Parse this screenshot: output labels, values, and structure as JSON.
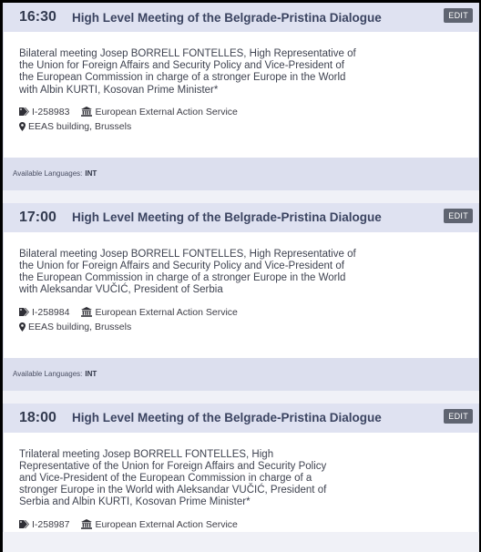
{
  "meetings": [
    {
      "time": "16:30",
      "title": "High Level Meeting of the Belgrade-Pristina Dialogue",
      "edit_label": "EDIT",
      "description": "Bilateral meeting Josep BORRELL FONTELLES, High Representative of the Union for Foreign Affairs and Security Policy and Vice-President of the European Commission in charge of a stronger Europe in the World with Albin KURTI, Kosovan Prime Minister*",
      "reference": "I-258983",
      "organizer": "European External Action Service",
      "location": "EEAS building, Brussels",
      "languages_label": "Available Languages:",
      "languages": "INT"
    },
    {
      "time": "17:00",
      "title": "High Level Meeting of the Belgrade-Pristina Dialogue",
      "edit_label": "EDIT",
      "description": "Bilateral meeting Josep BORRELL FONTELLES, High Representative of the Union for Foreign Affairs and Security Policy and Vice-President of the European Commission in charge of a stronger Europe in the World with Aleksandar VUČIĆ, President of Serbia",
      "reference": "I-258984",
      "organizer": "European External Action Service",
      "location": "EEAS building, Brussels",
      "languages_label": "Available Languages:",
      "languages": "INT"
    },
    {
      "time": "18:00",
      "title": "High Level Meeting of the Belgrade-Pristina Dialogue",
      "edit_label": "EDIT",
      "description": "Trilateral meeting Josep BORRELL FONTELLES, High Representative of the Union for Foreign Affairs and Security Policy and Vice-President of the European Commission in charge of a stronger Europe in the World with Aleksandar VUČIĆ, President of Serbia and Albin KURTI, Kosovan Prime Minister*",
      "reference": "I-258987",
      "organizer": "European External Action Service"
    }
  ],
  "icons": {
    "reference": "tag-icon",
    "organizer": "institution-icon",
    "location": "map-marker-icon"
  },
  "colors": {
    "header_bg": "#dfe2f1",
    "edit_button": "#5f6471",
    "frame": "#000000"
  }
}
